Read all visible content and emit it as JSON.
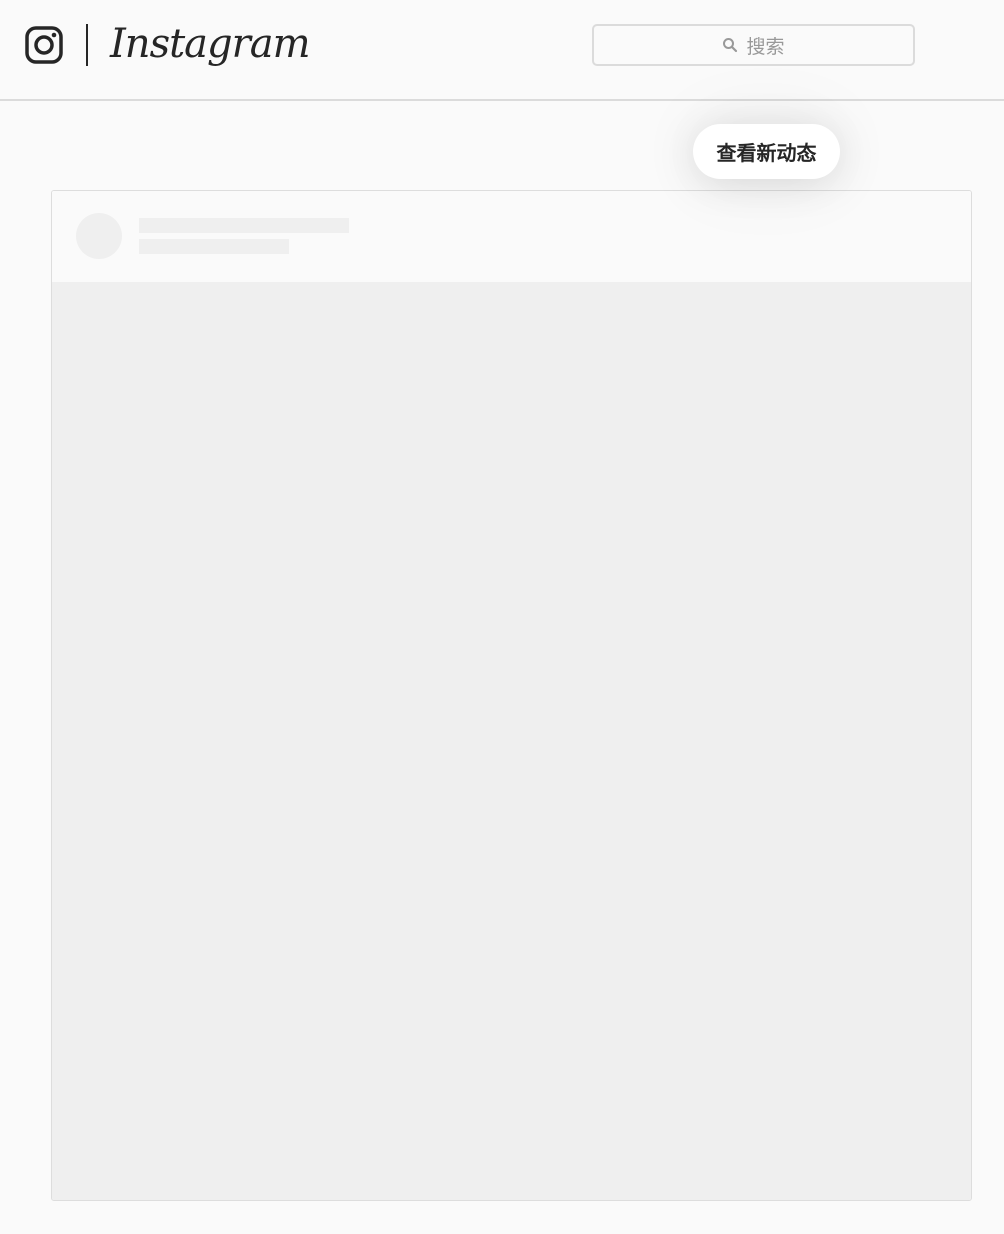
{
  "header": {
    "logo_text": "Instagram",
    "search": {
      "placeholder": "搜索"
    }
  },
  "feed": {
    "new_posts_label": "查看新动态"
  },
  "icons": {
    "camera": "instagram-camera-icon",
    "search": "search-icon"
  },
  "colors": {
    "background": "#fafafa",
    "border": "#dbdbdb",
    "placeholder_skeleton": "#efefef",
    "text_primary": "#262626",
    "text_muted": "#999999"
  }
}
